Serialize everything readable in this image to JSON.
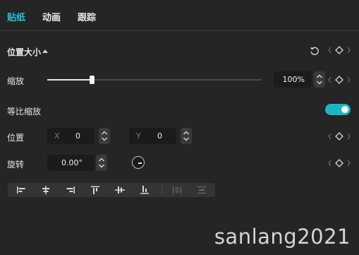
{
  "tabs": [
    {
      "label": "贴纸",
      "active": true
    },
    {
      "label": "动画",
      "active": false
    },
    {
      "label": "跟踪",
      "active": false
    }
  ],
  "section": {
    "title": "位置大小",
    "reset_icon": "reset-icon",
    "keyframe_icons": [
      "chevron-left-icon",
      "keyframe-diamond-icon",
      "chevron-right-icon"
    ]
  },
  "scale": {
    "label": "缩放",
    "value": "100%",
    "slider_fraction": 0.2
  },
  "uniform_scale": {
    "label": "等比缩放",
    "enabled": true
  },
  "position": {
    "label": "位置",
    "x_prefix": "X",
    "x_value": "0",
    "y_prefix": "Y",
    "y_value": "0"
  },
  "rotation": {
    "label": "旋转",
    "value": "0.00°"
  },
  "align_toolbar": {
    "icons": [
      "align-left-icon",
      "align-horizontal-center-icon",
      "align-right-icon",
      "align-top-icon",
      "align-vertical-center-icon",
      "align-bottom-icon",
      "distribute-horizontal-icon",
      "distribute-vertical-icon"
    ]
  },
  "colors": {
    "accent": "#22c4d6",
    "background": "#252526",
    "field": "#1b1b1b"
  },
  "watermark": "sanlang2021"
}
